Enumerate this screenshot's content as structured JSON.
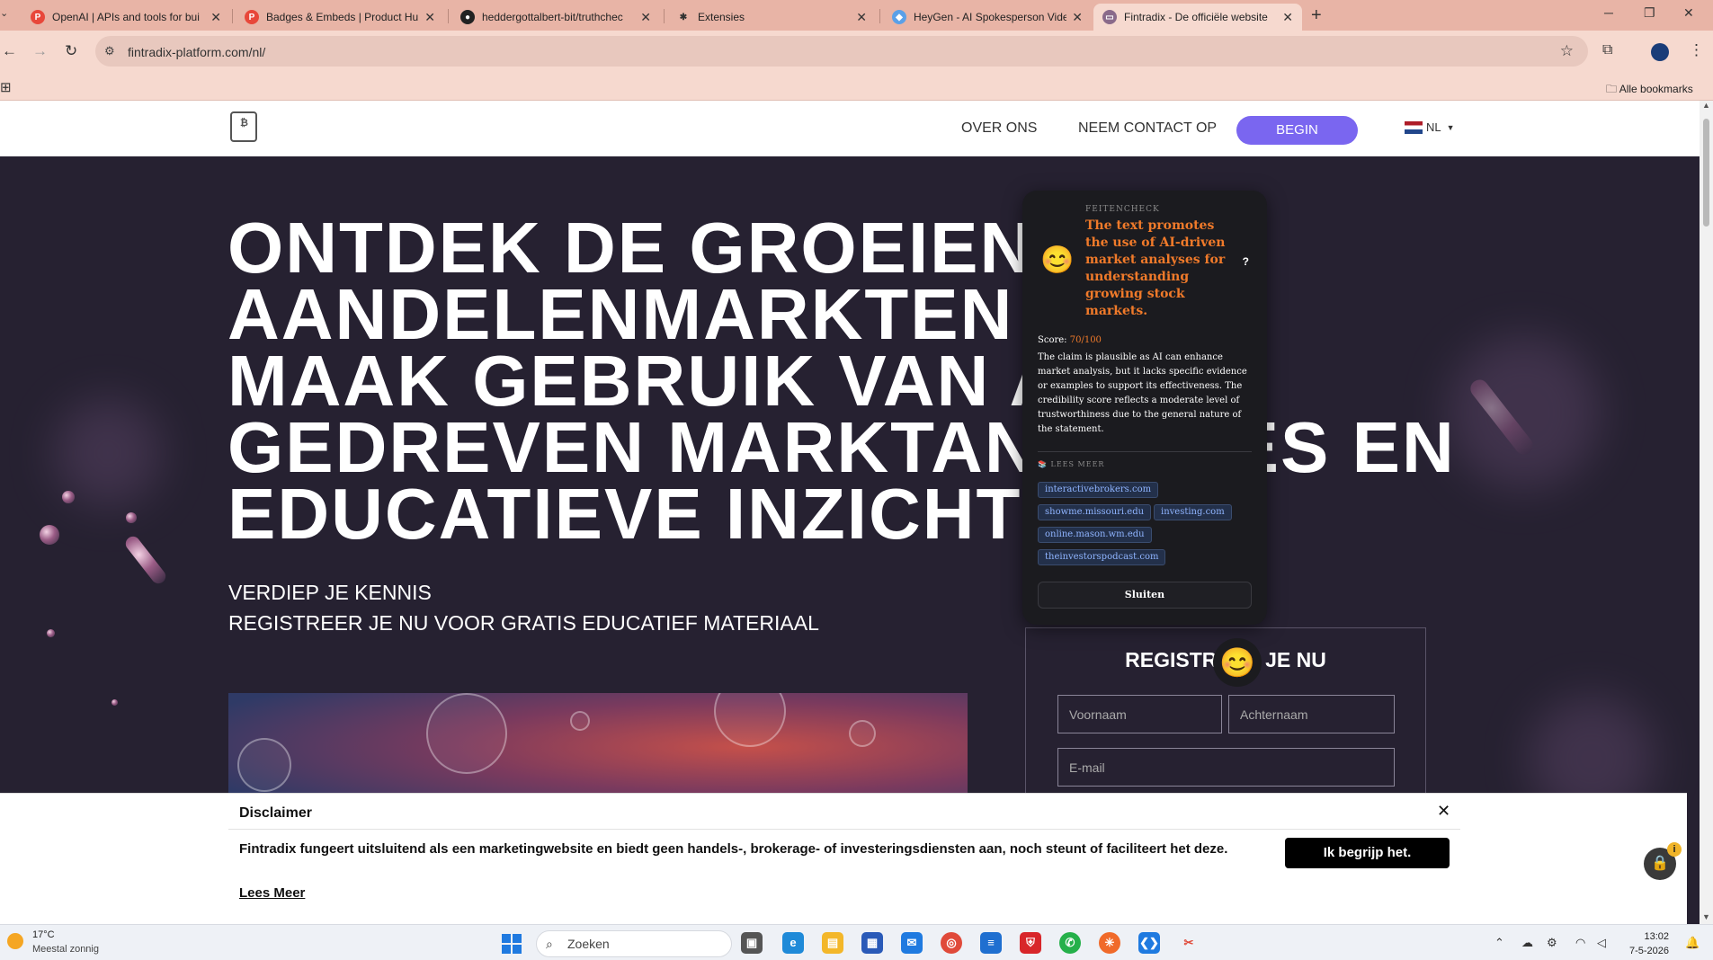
{
  "browser": {
    "tabs": [
      {
        "title": "OpenAI | APIs and tools for bui",
        "favicon": "P",
        "favicon_color": "#e8473a"
      },
      {
        "title": "Badges & Embeds | Product Hu",
        "favicon": "P",
        "favicon_color": "#e8473a"
      },
      {
        "title": "heddergottalbert-bit/truthchec",
        "favicon": "●",
        "favicon_color": "#222222"
      },
      {
        "title": "Extensies",
        "favicon": "✱",
        "favicon_color": "#333333"
      },
      {
        "title": "HeyGen - AI Spokesperson Vide",
        "favicon": "◆",
        "favicon_color": "#5aa0e8"
      },
      {
        "title": "Fintradix - De officiële website",
        "favicon": "▭",
        "favicon_color": "#8a6a8a"
      }
    ],
    "url": "fintradix-platform.com/nl/",
    "bookmarks_label": "Alle bookmarks"
  },
  "site": {
    "nav": {
      "about": "OVER ONS",
      "contact": "NEEM CONTACT OP",
      "begin": "BEGIN",
      "lang": "NL"
    },
    "headline": [
      "ONTDEK DE GROEIENDE",
      "AANDELENMARKTEN",
      "MAAK GEBRUIK VAN AI-",
      "GEDREVEN MARKTANALYSES EN",
      "EDUCATIEVE INZICHTEN"
    ],
    "sub1": "VERDIEP JE KENNIS",
    "sub2": "REGISTREER JE NU VOOR GRATIS EDUCATIEF MATERIAAL",
    "form": {
      "title": "REGISTREER JE NU",
      "first_name": "Voornaam",
      "last_name": "Achternaam",
      "email": "E-mail"
    }
  },
  "factcheck": {
    "label": "FEITENCHECK",
    "emoji": "😊",
    "title": "The text promotes the use of AI-driven market analyses for understanding growing stock markets.",
    "help": "?",
    "score_label": "Score:",
    "score_value": "70/100",
    "body": "The claim is plausible as AI can enhance market analysis, but it lacks specific evidence or examples to support its effectiveness. The credibility score reflects a moderate level of trustworthiness due to the general nature of the statement.",
    "more_label": "LEES MEER",
    "sources": [
      "interactivebrokers.com",
      "showme.missouri.edu",
      "investing.com",
      "online.mason.wm.edu",
      "theinvestorspodcast.com"
    ],
    "close": "Sluiten"
  },
  "disclaimer": {
    "title": "Disclaimer",
    "text": "Fintradix fungeert uitsluitend als een marketingwebsite en biedt geen handels-, brokerage- of investeringsdiensten aan, noch steunt of faciliteert het deze.",
    "more": "Lees Meer",
    "button": "Ik begrijp het."
  },
  "taskbar": {
    "temp": "17°C",
    "condition": "Meestal zonnig",
    "search": "Zoeken",
    "time": "13:02",
    "date": "7-5-2026"
  }
}
